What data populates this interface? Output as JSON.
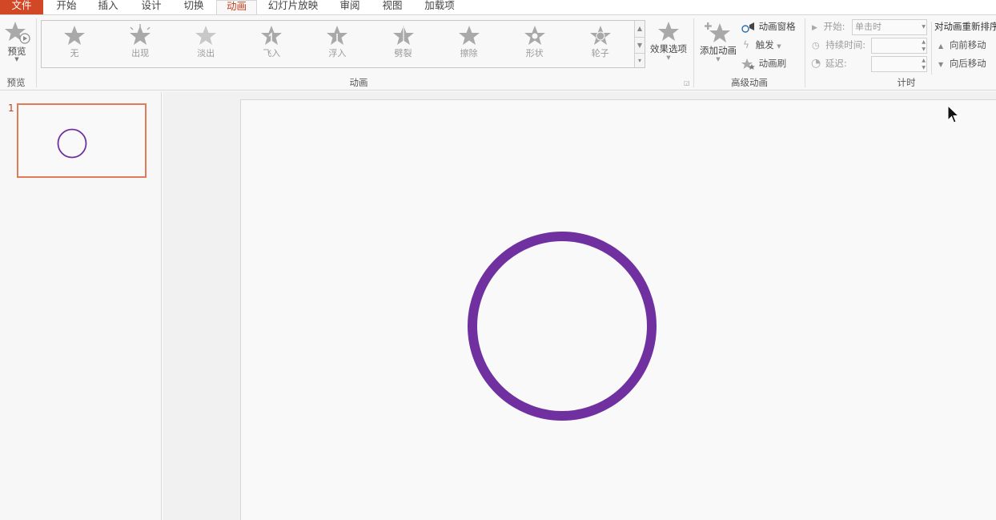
{
  "tabs": {
    "file": "文件",
    "home": "开始",
    "insert": "插入",
    "design": "设计",
    "transitions": "切换",
    "animations": "动画",
    "slideshow": "幻灯片放映",
    "review": "审阅",
    "view": "视图",
    "addins": "加载项"
  },
  "preview_group": {
    "button_label": "预览",
    "group_label": "预览"
  },
  "animation_group": {
    "gallery": [
      {
        "label": "无",
        "icon": "star-none-icon"
      },
      {
        "label": "出现",
        "icon": "star-appear-icon"
      },
      {
        "label": "淡出",
        "icon": "star-fade-icon"
      },
      {
        "label": "飞入",
        "icon": "star-fly-in-icon"
      },
      {
        "label": "浮入",
        "icon": "star-float-in-icon"
      },
      {
        "label": "劈裂",
        "icon": "star-split-icon"
      },
      {
        "label": "擦除",
        "icon": "star-wipe-icon"
      },
      {
        "label": "形状",
        "icon": "star-shape-icon"
      },
      {
        "label": "轮子",
        "icon": "star-wheel-icon"
      }
    ],
    "effect_options": "效果选项",
    "group_label": "动画"
  },
  "advanced_group": {
    "add_animation": "添加动画",
    "animation_pane": "动画窗格",
    "trigger": "触发",
    "animation_painter": "动画刷",
    "group_label": "高级动画"
  },
  "timing_group": {
    "start_label": "开始:",
    "start_value": "单击时",
    "duration_label": "持续时间:",
    "delay_label": "延迟:",
    "reorder_title": "对动画重新排序",
    "move_earlier": "向前移动",
    "move_later": "向后移动",
    "group_label": "计时"
  },
  "thumbnails": {
    "slide_number": "1"
  },
  "colors": {
    "accent": "#c43e1c",
    "file_tab": "#d24726",
    "circle": "#7030a0",
    "thumb_border": "#e07b5a"
  }
}
